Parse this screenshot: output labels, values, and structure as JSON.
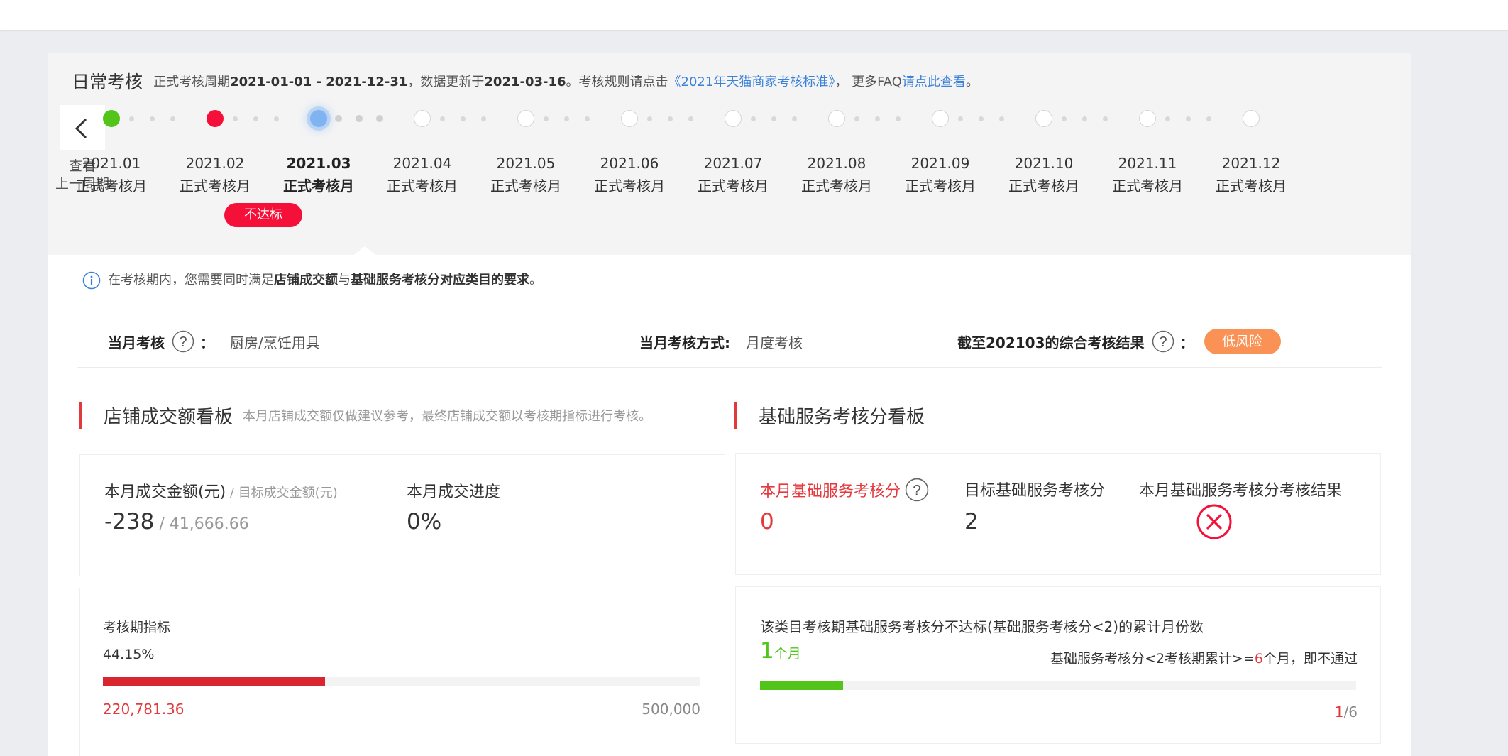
{
  "header": {
    "title": "日常考核",
    "period_prefix": "正式考核周期",
    "period": "2021-01-01 - 2021-12-31",
    "updated_prefix": "，数据更新于",
    "updated": "2021-03-16",
    "rules_prefix": "。考核规则请点击",
    "rules_link": "《2021年天猫商家考核标准》",
    "faq_prefix": "，  更多FAQ",
    "faq_link": "请点此查看",
    "faq_suffix": "。"
  },
  "prev_cycle": {
    "line1": "查看",
    "line2": "上一周期",
    "icon": "chevron-left-icon"
  },
  "timeline": [
    {
      "date": "2021.01",
      "label": "正式考核月",
      "status": "pass"
    },
    {
      "date": "2021.02",
      "label": "正式考核月",
      "status": "fail",
      "badge": "不达标"
    },
    {
      "date": "2021.03",
      "label": "正式考核月",
      "status": "current"
    },
    {
      "date": "2021.04",
      "label": "正式考核月",
      "status": "future"
    },
    {
      "date": "2021.05",
      "label": "正式考核月",
      "status": "future"
    },
    {
      "date": "2021.06",
      "label": "正式考核月",
      "status": "future"
    },
    {
      "date": "2021.07",
      "label": "正式考核月",
      "status": "future"
    },
    {
      "date": "2021.08",
      "label": "正式考核月",
      "status": "future"
    },
    {
      "date": "2021.09",
      "label": "正式考核月",
      "status": "future"
    },
    {
      "date": "2021.10",
      "label": "正式考核月",
      "status": "future"
    },
    {
      "date": "2021.11",
      "label": "正式考核月",
      "status": "future"
    },
    {
      "date": "2021.12",
      "label": "正式考核月",
      "status": "future"
    }
  ],
  "note": {
    "prefix": "在考核期内，您需要同时满足",
    "bold1": "店铺成交额",
    "mid": "与",
    "bold2": "基础服务考核分对应类目的要求",
    "suffix": "。"
  },
  "summary": {
    "month_label": "当月考核",
    "month_colon": "：",
    "month_value": "厨房/烹饪用具",
    "method_label": "当月考核方式:",
    "method_value": "月度考核",
    "result_label": "截至202103的综合考核结果",
    "result_colon": "：",
    "risk": "低风险"
  },
  "sales": {
    "title": "店铺成交额看板",
    "subtitle": "本月店铺成交额仅做建议参考，最终店铺成交额以考核期指标进行考核。",
    "amount_label": "本月成交金额(元)",
    "slash": " / ",
    "target_label": "目标成交金额(元)",
    "amount": "-238",
    "target": "41,666.66",
    "progress_label": "本月成交进度",
    "progress": "0%",
    "period_label": "考核期指标",
    "period_percent": "44.15%",
    "period_fraction": 0.3716,
    "period_current": "220,781.36",
    "period_target": "500,000"
  },
  "service": {
    "title": "基础服务考核分看板",
    "score_label": "本月基础服务考核分",
    "score": "0",
    "target_label": "目标基础服务考核分",
    "target": "2",
    "result_label": "本月基础服务考核分考核结果",
    "result_icon": "fail-x-icon",
    "fail_label": "该类目考核期基础服务考核分不达标(基础服务考核分<2)的累计月份数",
    "fail_count": "1",
    "fail_unit": "个月",
    "rule_prefix": "基础服务考核分<2考核期累计>=",
    "rule_num": "6",
    "rule_suffix": "个月，即不通过",
    "fail_fraction": 0.1389,
    "count_current": "1",
    "count_total": "/6"
  },
  "colors": {
    "pass": "#52c41a",
    "fail": "#f5103a",
    "current": "#7fb3f2",
    "accent_red": "#e4393c",
    "risk_orange": "#fb9255",
    "link": "#3b82d8"
  }
}
